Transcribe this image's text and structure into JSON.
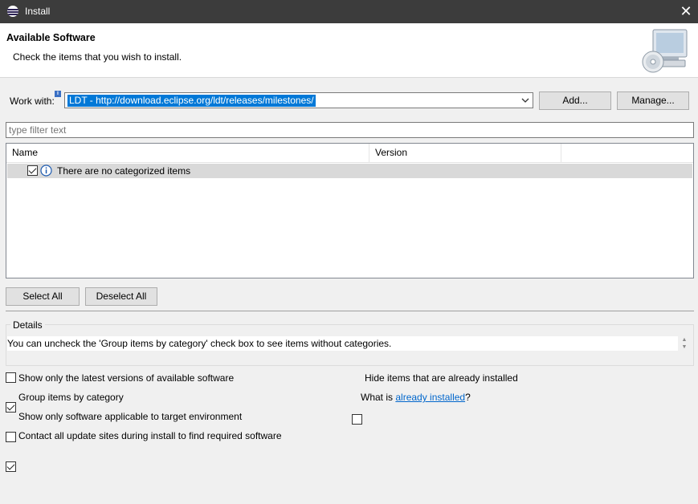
{
  "window": {
    "title": "Install",
    "close_glyph": "✕",
    "icon": "eclipse-icon"
  },
  "banner": {
    "title": "Available Software",
    "subtitle": "Check the items that you wish to install.",
    "icon": "software-install-icon"
  },
  "work_with": {
    "label": "Work with:",
    "info_glyph": "i",
    "value": "LDT - http://download.eclipse.org/ldt/releases/milestones/",
    "add_label": "Add...",
    "manage_label": "Manage..."
  },
  "filter": {
    "placeholder": "type filter text"
  },
  "tree": {
    "columns": [
      "Name",
      "Version"
    ],
    "rows": [
      {
        "checked": true,
        "icon": "info-icon",
        "name": "There are no categorized items",
        "version": ""
      }
    ]
  },
  "selection": {
    "select_all_label": "Select All",
    "deselect_all_label": "Deselect All"
  },
  "details": {
    "label": "Details",
    "text": "You can uncheck the 'Group items by category' check box to see items without categories."
  },
  "options": {
    "latest_versions": {
      "label": "Show only the latest versions of available software",
      "checked": false
    },
    "group_by_category": {
      "label": "Group items by category",
      "checked": true
    },
    "applicable_target": {
      "label": "Show only software applicable to target environment",
      "checked": false
    },
    "contact_all_sites": {
      "label": "Contact all update sites during install to find required software",
      "checked": true
    },
    "hide_installed": {
      "label": "Hide items that are already installed",
      "checked": false
    },
    "what_is_prefix": "What is",
    "already_installed_link": "already installed",
    "what_is_suffix": "?"
  },
  "colors": {
    "selection": "#0078d7",
    "link": "#0066cc",
    "titlebar": "#3c3c3c"
  }
}
